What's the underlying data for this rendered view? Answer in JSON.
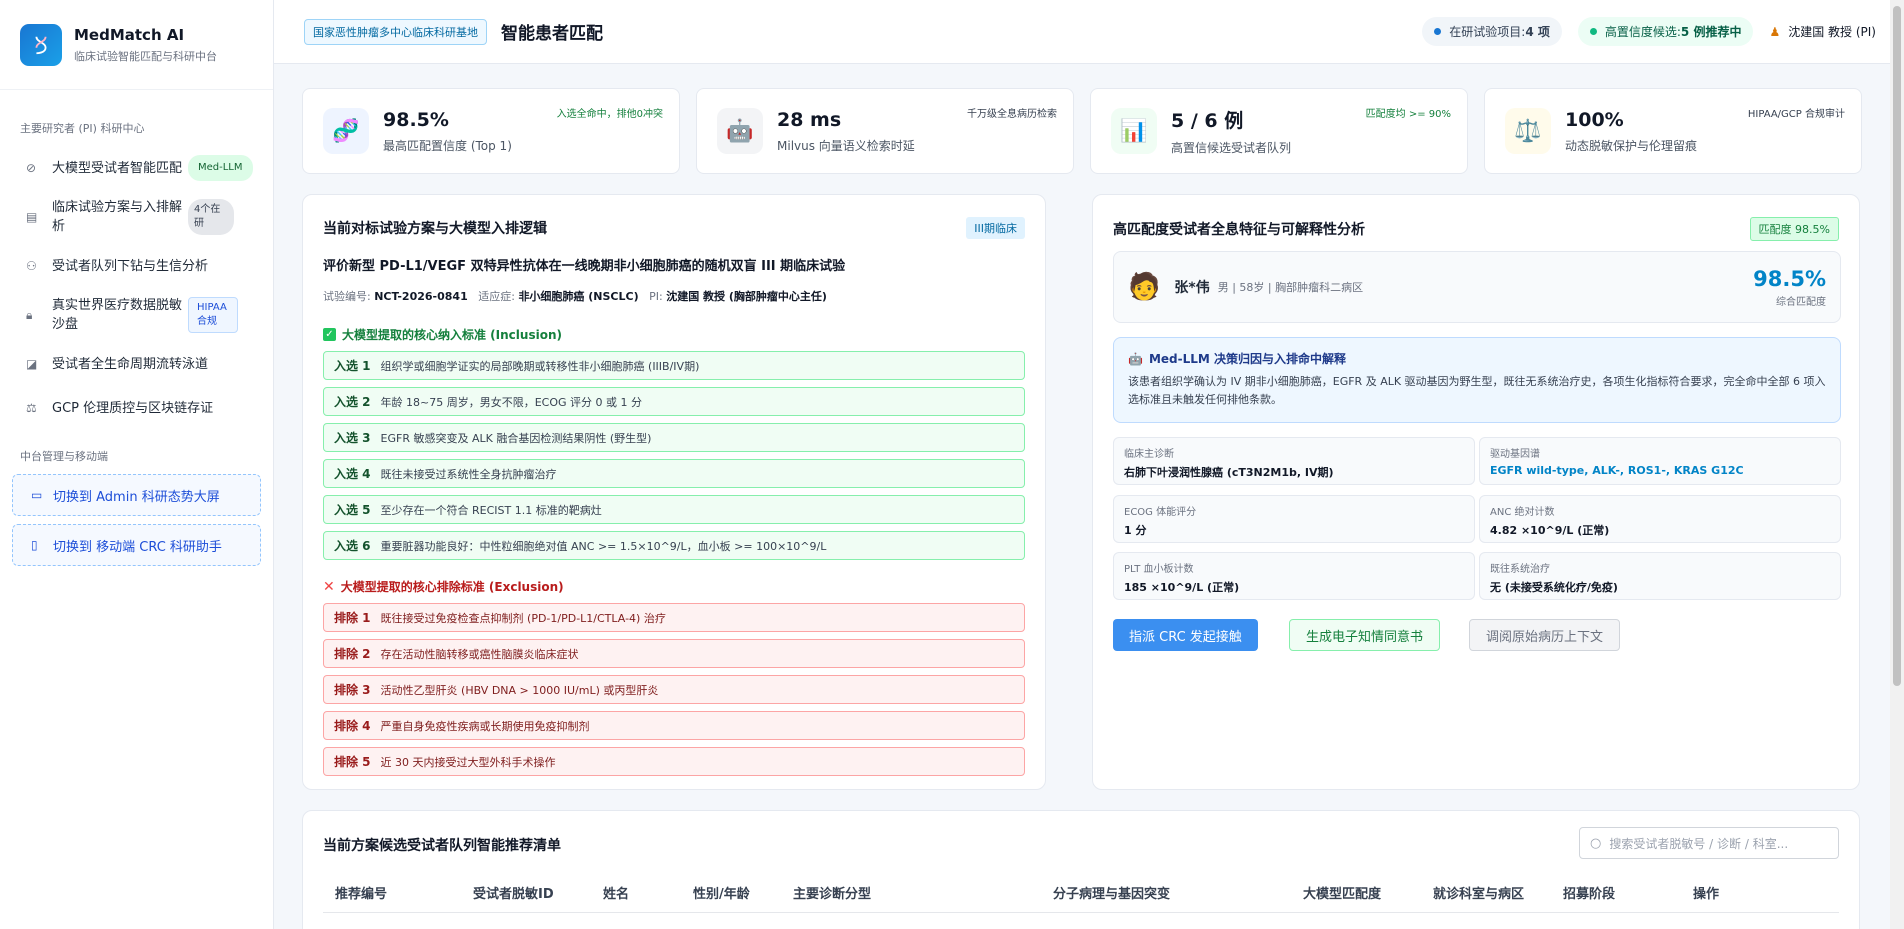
{
  "brand": {
    "name": "MedMatch AI",
    "subtitle": "临床试验智能匹配与科研中台",
    "logo_icon": "dna-icon"
  },
  "sidebar": {
    "section1": "主要研究者 (PI) 科研中心",
    "items": [
      {
        "label": "大模型受试者智能匹配",
        "badge": "Med-LLM",
        "icon": "compass-icon"
      },
      {
        "label": "临床试验方案与入排解析",
        "badge": "4个在研",
        "icon": "document-icon"
      },
      {
        "label": "受试者队列下钻与生信分析",
        "badge": "",
        "icon": "person-icon"
      },
      {
        "label": "真实世界医疗数据脱敏沙盘",
        "badge": "HIPAA合规",
        "icon": "lock-icon"
      },
      {
        "label": "受试者全生命周期流转泳道",
        "badge": "",
        "icon": "chart-icon"
      },
      {
        "label": "GCP 伦理质控与区块链存证",
        "badge": "",
        "icon": "audit-icon"
      }
    ],
    "section2": "中台管理与移动端",
    "switch_admin": "切换到 Admin 科研态势大屏",
    "switch_mobile": "切换到 移动端 CRC 科研助手"
  },
  "header": {
    "org_tag": "国家恶性肿瘤多中心临床科研基地",
    "title": "智能患者匹配",
    "trials_label": "在研试验项目: ",
    "trials_value": "4 项",
    "candidates_label": "高置信度候选: ",
    "candidates_value": "5 例推荐中",
    "user": "沈建国 教授 (PI)",
    "colors": {
      "blue_dot": "#1976d2",
      "green_dot": "#10b981"
    }
  },
  "stats": [
    {
      "value": "98.5%",
      "label": "最高匹配置信度 (Top 1)",
      "note": "入选全命中，排他0冲突",
      "icon": "dna-icon"
    },
    {
      "value": "28 ms",
      "label": "Milvus 向量语义检索时延",
      "note": "千万级全息病历检索",
      "icon": "robot-icon"
    },
    {
      "value": "5 / 6 例",
      "label": "高置信候选受试者队列",
      "note": "匹配度均 >= 90%",
      "icon": "bar-chart-icon"
    },
    {
      "value": "100%",
      "label": "动态脱敏保护与伦理留痕",
      "note": "HIPAA/GCP 合规审计",
      "icon": "scale-icon"
    }
  ],
  "trial": {
    "panel_title": "当前对标试验方案与大模型入排逻辑",
    "phase_tag": "III期临床",
    "name": "评价新型 PD-L1/VEGF 双特异性抗体在一线晚期非小细胞肺癌的随机双盲 III 期临床试验",
    "id_label": "试验编号: ",
    "id_value": "NCT-2026-0841",
    "indication_label": "适应症: ",
    "indication_value": "非小细胞肺癌 (NSCLC)",
    "pi_label": "PI: ",
    "pi_value": "沈建国 教授 (胸部肿瘤中心主任)",
    "inclusion_title": "大模型提取的核心纳入标准 (Inclusion)",
    "inclusion": [
      {
        "tag": "入选 1",
        "text": "组织学或细胞学证实的局部晚期或转移性非小细胞肺癌 (IIIB/IV期)"
      },
      {
        "tag": "入选 2",
        "text": "年龄 18~75 周岁，男女不限，ECOG 评分 0 或 1 分"
      },
      {
        "tag": "入选 3",
        "text": "EGFR 敏感突变及 ALK 融合基因检测结果阴性 (野生型)"
      },
      {
        "tag": "入选 4",
        "text": "既往未接受过系统性全身抗肿瘤治疗"
      },
      {
        "tag": "入选 5",
        "text": "至少存在一个符合 RECIST 1.1 标准的靶病灶"
      },
      {
        "tag": "入选 6",
        "text": "重要脏器功能良好：中性粒细胞绝对值 ANC >= 1.5×10^9/L，血小板 >= 100×10^9/L"
      }
    ],
    "exclusion_title": "大模型提取的核心排除标准 (Exclusion)",
    "exclusion": [
      {
        "tag": "排除 1",
        "text": "既往接受过免疫检查点抑制剂 (PD-1/PD-L1/CTLA-4) 治疗"
      },
      {
        "tag": "排除 2",
        "text": "存在活动性脑转移或癌性脑膜炎临床症状"
      },
      {
        "tag": "排除 3",
        "text": "活动性乙型肝炎 (HBV DNA > 1000 IU/mL) 或丙型肝炎"
      },
      {
        "tag": "排除 4",
        "text": "严重自身免疫性疾病或长期使用免疫抑制剂"
      },
      {
        "tag": "排除 5",
        "text": "近 30 天内接受过大型外科手术操作"
      }
    ]
  },
  "patient": {
    "panel_title": "高匹配度受试者全息特征与可解释性分析",
    "match_tag": "匹配度 98.5%",
    "name": "张*伟",
    "meta": "男 | 58岁 | 胸部肿瘤科二病区",
    "score": "98.5%",
    "score_label": "综合匹配度",
    "explain_title": "Med-LLM 决策归因与入排命中解释",
    "explain_text": "该患者组织学确认为 IV 期非小细胞肺癌，EGFR 及 ALK 驱动基因为野生型，既往无系统治疗史，各项生化指标符合要求，完全命中全部 6 项入选标准且未触发任何排他条款。",
    "features": [
      {
        "key": "临床主诊断",
        "value": "右肺下叶浸润性腺癌 (cT3N2M1b, IV期)",
        "highlight": false
      },
      {
        "key": "驱动基因谱",
        "value": "EGFR wild-type, ALK-, ROS1-, KRAS G12C",
        "highlight": true
      },
      {
        "key": "ECOG 体能评分",
        "value": "1 分",
        "highlight": false
      },
      {
        "key": "ANC 绝对计数",
        "value": "4.82 ×10^9/L (正常)",
        "highlight": false
      },
      {
        "key": "PLT 血小板计数",
        "value": "185 ×10^9/L (正常)",
        "highlight": false
      },
      {
        "key": "既往系统治疗",
        "value": "无 (未接受系统化疗/免疫)",
        "highlight": false
      }
    ],
    "btn_assign": "指派 CRC 发起接触",
    "btn_consent": "生成电子知情同意书",
    "btn_records": "调阅原始病历上下文"
  },
  "list": {
    "title": "当前方案候选受试者队列智能推荐清单",
    "search_placeholder": "搜索受试者脱敏号 / 诊断 / 科室...",
    "columns": [
      "推荐编号",
      "受试者脱敏ID",
      "姓名",
      "性别/年龄",
      "主要诊断分型",
      "分子病理与基因突变",
      "大模型匹配度",
      "就诊科室与病区",
      "招募阶段",
      "操作"
    ]
  }
}
